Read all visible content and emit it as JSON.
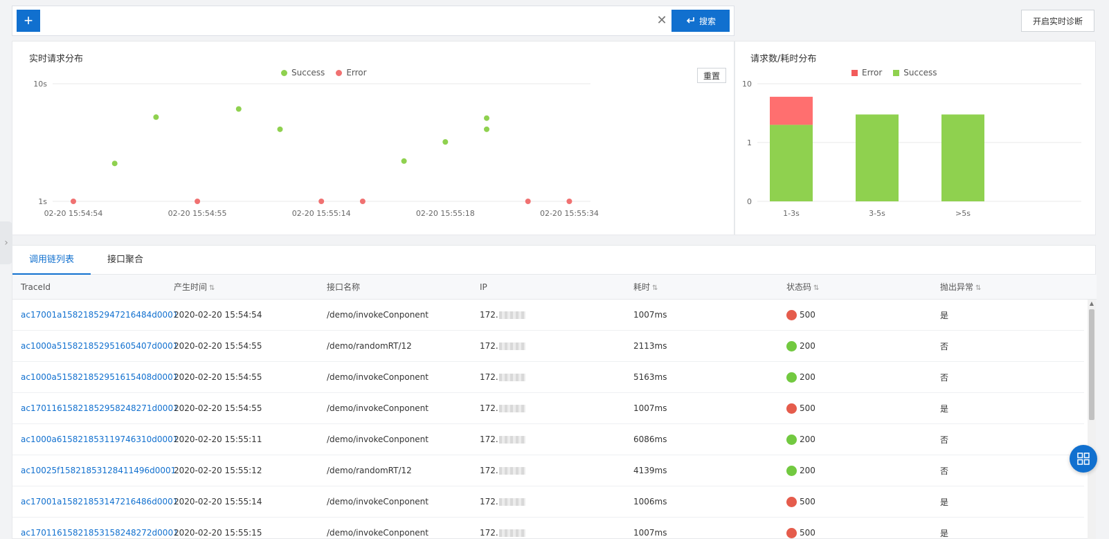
{
  "toolbar": {
    "add_label": "+",
    "search_label": "搜索",
    "diagnose_label": "开启实时诊断"
  },
  "scatter_panel": {
    "title": "实时请求分布",
    "reset_label": "重置",
    "legend": [
      {
        "name": "Success",
        "color": "#8fd14f"
      },
      {
        "name": "Error",
        "color": "#f07171"
      }
    ]
  },
  "bar_panel": {
    "title": "请求数/耗时分布",
    "legend": [
      {
        "name": "Error",
        "color": "#f25b5b"
      },
      {
        "name": "Success",
        "color": "#8fd14f"
      }
    ]
  },
  "chart_data": [
    {
      "type": "scatter",
      "title": "实时请求分布",
      "y_scale": "log",
      "y_ticks": [
        "10s",
        "1s"
      ],
      "ylim": [
        1,
        10
      ],
      "x_ticks": [
        "02-20 15:54:54",
        "02-20 15:54:55",
        "02-20 15:55:14",
        "02-20 15:55:18",
        "02-20 15:55:34"
      ],
      "series": [
        {
          "name": "Success",
          "color": "#8fd14f",
          "points": [
            {
              "x": 1,
              "y": 2.1
            },
            {
              "x": 2,
              "y": 5.2
            },
            {
              "x": 4,
              "y": 6.1
            },
            {
              "x": 5,
              "y": 4.1
            },
            {
              "x": 8,
              "y": 2.2
            },
            {
              "x": 9,
              "y": 3.2
            },
            {
              "x": 10,
              "y": 4.1
            },
            {
              "x": 10,
              "y": 5.1
            }
          ]
        },
        {
          "name": "Error",
          "color": "#f07171",
          "points": [
            {
              "x": 0,
              "y": 1.0
            },
            {
              "x": 3,
              "y": 1.0
            },
            {
              "x": 6,
              "y": 1.0
            },
            {
              "x": 7,
              "y": 1.0
            },
            {
              "x": 11,
              "y": 1.0
            },
            {
              "x": 12,
              "y": 1.0
            }
          ]
        }
      ],
      "legend_position": "top-center",
      "grid": true
    },
    {
      "type": "bar",
      "title": "请求数/耗时分布",
      "stacked": true,
      "y_scale": "log",
      "y_ticks": [
        "10",
        "1",
        "0"
      ],
      "categories": [
        "1-3s",
        "3-5s",
        ">5s"
      ],
      "series": [
        {
          "name": "Success",
          "color": "#8fd14f",
          "values": [
            2,
            3,
            3
          ]
        },
        {
          "name": "Error",
          "color": "#ff6f6f",
          "values": [
            4,
            0,
            0
          ]
        }
      ],
      "legend_position": "top-center",
      "grid": true
    }
  ],
  "tabs": [
    {
      "label": "调用链列表",
      "active": true
    },
    {
      "label": "接口聚合",
      "active": false
    }
  ],
  "table": {
    "headers": [
      "TraceId",
      "产生时间",
      "接口名称",
      "IP",
      "耗时",
      "状态码",
      "抛出异常"
    ],
    "sortable": [
      false,
      true,
      false,
      false,
      true,
      true,
      true
    ],
    "rows": [
      {
        "trace": "ac17001a15821852947216484d0001",
        "time": "2020-02-20 15:54:54",
        "api": "/demo/invokeConponent",
        "ip": "172.",
        "cost": "1007ms",
        "status": "500",
        "status_color": "#e55c4c",
        "exception": "是"
      },
      {
        "trace": "ac1000a515821852951605407d0001",
        "time": "2020-02-20 15:54:55",
        "api": "/demo/randomRT/12",
        "ip": "172.",
        "cost": "2113ms",
        "status": "200",
        "status_color": "#72c940",
        "exception": "否"
      },
      {
        "trace": "ac1000a515821852951615408d0001",
        "time": "2020-02-20 15:54:55",
        "api": "/demo/invokeConponent",
        "ip": "172.",
        "cost": "5163ms",
        "status": "200",
        "status_color": "#72c940",
        "exception": "否"
      },
      {
        "trace": "ac17011615821852958248271d0001",
        "time": "2020-02-20 15:54:55",
        "api": "/demo/invokeConponent",
        "ip": "172.",
        "cost": "1007ms",
        "status": "500",
        "status_color": "#e55c4c",
        "exception": "是"
      },
      {
        "trace": "ac1000a615821853119746310d0001",
        "time": "2020-02-20 15:55:11",
        "api": "/demo/invokeConponent",
        "ip": "172.",
        "cost": "6086ms",
        "status": "200",
        "status_color": "#72c940",
        "exception": "否"
      },
      {
        "trace": "ac10025f15821853128411496d0001",
        "time": "2020-02-20 15:55:12",
        "api": "/demo/randomRT/12",
        "ip": "172.",
        "cost": "4139ms",
        "status": "200",
        "status_color": "#72c940",
        "exception": "否"
      },
      {
        "trace": "ac17001a15821853147216486d0001",
        "time": "2020-02-20 15:55:14",
        "api": "/demo/invokeConponent",
        "ip": "172.",
        "cost": "1006ms",
        "status": "500",
        "status_color": "#e55c4c",
        "exception": "是"
      },
      {
        "trace": "ac17011615821853158248272d0001",
        "time": "2020-02-20 15:55:15",
        "api": "/demo/invokeConponent",
        "ip": "172.",
        "cost": "1007ms",
        "status": "500",
        "status_color": "#e55c4c",
        "exception": "是"
      }
    ]
  },
  "icons": {
    "clear": "close-icon",
    "search": "enter-icon",
    "collapse": "chevron-right-icon",
    "fab": "grid-icon"
  },
  "colors": {
    "primary": "#1170cf",
    "success": "#8fd14f",
    "error": "#f07171"
  }
}
